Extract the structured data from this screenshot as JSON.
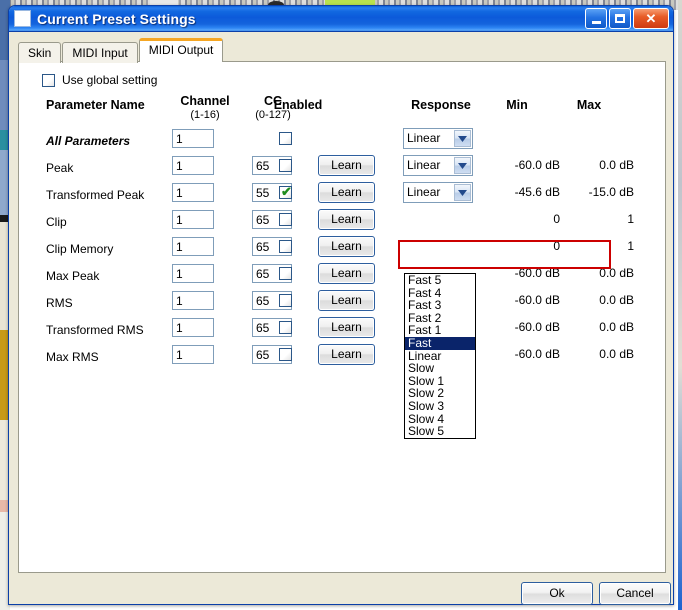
{
  "window": {
    "title": "Current Preset Settings",
    "icon": "window-icon",
    "buttons": {
      "minimize": "minimize-icon",
      "maximize": "maximize-icon",
      "close": "close-icon"
    }
  },
  "tabs": [
    {
      "label": "Skin",
      "active": false
    },
    {
      "label": "MIDI Input",
      "active": false
    },
    {
      "label": "MIDI Output",
      "active": true
    }
  ],
  "global_setting": {
    "label": "Use global setting",
    "checked": false
  },
  "headers": {
    "parameter_name": "Parameter Name",
    "channel": "Channel",
    "channel_range": "(1-16)",
    "cc": "CC",
    "cc_range": "(0-127)",
    "enabled": "Enabled",
    "response": "Response",
    "min": "Min",
    "max": "Max"
  },
  "learn_label": "Learn",
  "rows": [
    {
      "name": "All Parameters",
      "emphasis": true,
      "channel": "1",
      "cc": "",
      "enabled": false,
      "has_cc": false,
      "has_learn": false,
      "response": "Linear",
      "min": "",
      "max": ""
    },
    {
      "name": "Peak",
      "emphasis": false,
      "channel": "1",
      "cc": "65",
      "enabled": false,
      "has_cc": true,
      "has_learn": true,
      "response": "Linear",
      "min": "-60.0 dB",
      "max": "0.0 dB"
    },
    {
      "name": "Transformed Peak",
      "emphasis": false,
      "channel": "1",
      "cc": "55",
      "enabled": true,
      "has_cc": true,
      "has_learn": true,
      "response": "Linear",
      "min": "-45.6 dB",
      "max": "-15.0 dB"
    },
    {
      "name": "Clip",
      "emphasis": false,
      "channel": "1",
      "cc": "65",
      "enabled": false,
      "has_cc": true,
      "has_learn": true,
      "response": "",
      "min": "0",
      "max": "1"
    },
    {
      "name": "Clip Memory",
      "emphasis": false,
      "channel": "1",
      "cc": "65",
      "enabled": false,
      "has_cc": true,
      "has_learn": true,
      "response": "",
      "min": "0",
      "max": "1"
    },
    {
      "name": "Max Peak",
      "emphasis": false,
      "channel": "1",
      "cc": "65",
      "enabled": false,
      "has_cc": true,
      "has_learn": true,
      "response": "",
      "min": "-60.0 dB",
      "max": "0.0 dB"
    },
    {
      "name": "RMS",
      "emphasis": false,
      "channel": "1",
      "cc": "65",
      "enabled": false,
      "has_cc": true,
      "has_learn": true,
      "response": "",
      "min": "-60.0 dB",
      "max": "0.0 dB"
    },
    {
      "name": "Transformed RMS",
      "emphasis": false,
      "channel": "1",
      "cc": "65",
      "enabled": false,
      "has_cc": true,
      "has_learn": true,
      "response": "",
      "min": "-60.0 dB",
      "max": "0.0 dB"
    },
    {
      "name": "Max RMS",
      "emphasis": false,
      "channel": "1",
      "cc": "65",
      "enabled": false,
      "has_cc": true,
      "has_learn": true,
      "response": "",
      "min": "-60.0 dB",
      "max": "0.0 dB"
    }
  ],
  "response_dropdown": {
    "open": true,
    "owner_row": "Transformed Peak",
    "selected": "Fast",
    "options": [
      "Fast 5",
      "Fast 4",
      "Fast 3",
      "Fast 2",
      "Fast 1",
      "Fast",
      "Linear",
      "Slow",
      "Slow 1",
      "Slow 2",
      "Slow 3",
      "Slow 4",
      "Slow 5"
    ]
  },
  "annotation": {
    "type": "red-highlight-rectangle",
    "target_row": "Transformed Peak",
    "color": "#cc0000"
  },
  "footer": {
    "ok_label": "Ok",
    "cancel_label": "Cancel"
  },
  "colors": {
    "titlebar_blue": "#1168e0",
    "dialog_face": "#ece9d8",
    "active_tab_accent": "#f5a623",
    "dropdown_highlight": "#0a246a",
    "checkbox_border": "#2b5788",
    "check_green": "#1f8c1f"
  }
}
